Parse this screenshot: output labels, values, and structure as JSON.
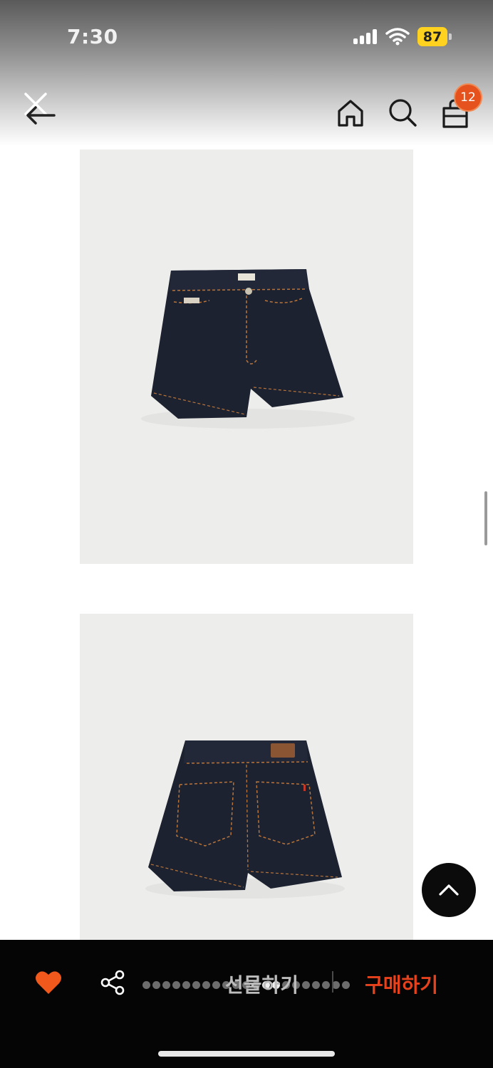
{
  "status_bar": {
    "time": "7:30",
    "battery": "87",
    "icons": [
      "signal-icon",
      "wifi-icon",
      "battery-icon"
    ]
  },
  "nav": {
    "back_icon": "back-close-icon",
    "home_icon": "home-icon",
    "search_icon": "search-icon",
    "bag_icon": "shopping-bag-icon",
    "bag_count": "12"
  },
  "product_images": [
    {
      "view": "front",
      "alt": "denim-shorts-front"
    },
    {
      "view": "back",
      "alt": "denim-shorts-back"
    }
  ],
  "floating": {
    "scroll_top_icon": "chevron-up-icon"
  },
  "bottom_bar": {
    "like_icon": "heart-icon",
    "share_icon": "share-icon",
    "gift_label": "선물하기",
    "buy_label": "구매하기"
  },
  "colors": {
    "accent": "#e8421d",
    "badge": "#e6521d",
    "heart": "#f0581c",
    "denim": "#1d2230",
    "stitch": "#b8743a",
    "image_bg": "#ededec",
    "battery": "#ffd21f"
  }
}
